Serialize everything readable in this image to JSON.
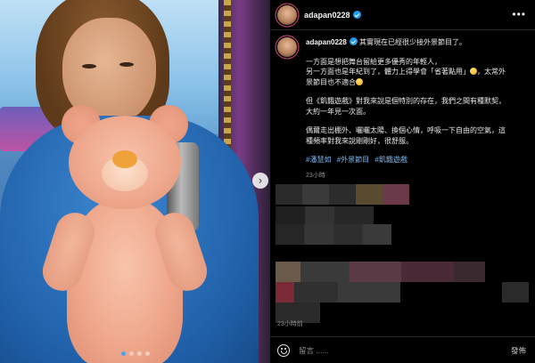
{
  "header": {
    "username": "adapan0228",
    "more_label": "•••"
  },
  "caption": {
    "username": "adapan0228",
    "first_line": "其實現在已經很少接外景節目了。",
    "para2_line1": "一方面是想把舞台留給更多優秀的年輕人，",
    "para2_line2a": "另一方面也是年紀到了，體力上得學會「省著點用」",
    "para2_line2b": "，太常外",
    "para2_line3": "景節目也不適合",
    "para3_line1": "但《飢餓遊戲》對我來說是個特別的存在，我們之間有種默契，",
    "para3_line2": "大約一年見一次面。",
    "para4_line1": "偶爾走出棚外、曬曬太陽、換個心情，呼吸一下自由的空氣，這",
    "para4_line2": "種頻率對我來說剛剛好，很舒服。",
    "tags": [
      "#潘慧如",
      "#外景節目",
      "#飢餓遊戲"
    ],
    "time": "23小時"
  },
  "post_time": "23小時前",
  "footer": {
    "placeholder": "留言 ......",
    "post_label": "發佈"
  },
  "carousel": {
    "slide_count": 4,
    "active_index": 0,
    "next_arrow": "›"
  },
  "colors": {
    "accent_blue": "#1d9bf0",
    "hashtag": "#7db8f2",
    "muted": "#8e8e8e",
    "ring": "#d84a7a"
  },
  "icons": [
    "verified-badge-icon",
    "more-options-icon",
    "emoji-icon",
    "next-arrow-icon",
    "sparkle-emoji-icon"
  ]
}
